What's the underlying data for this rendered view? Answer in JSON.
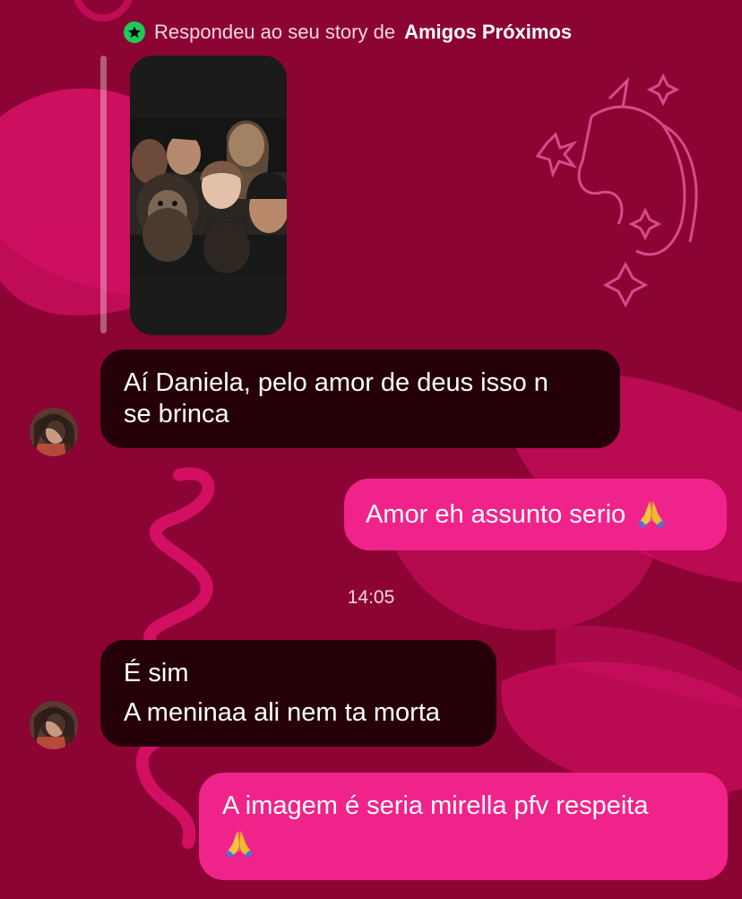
{
  "story_reply": {
    "icon": "star-icon",
    "prefix": "Respondeu ao seu story de",
    "highlight": "Amigos Próximos",
    "badge_color": "#1fc95a"
  },
  "messages": [
    {
      "direction": "incoming",
      "lines": [
        "Aí Daniela, pelo amor de deus isso n",
        "se brinca"
      ]
    },
    {
      "direction": "outgoing",
      "text": "Amor eh assunto serio",
      "emoji": "praying-hands-icon"
    },
    {
      "timestamp": "14:05"
    },
    {
      "direction": "incoming",
      "lines": [
        "É sim",
        "A meninaa ali nem ta morta"
      ]
    },
    {
      "direction": "outgoing",
      "text": "A imagem é seria mirella pfv respeita",
      "emoji": "praying-hands-icon"
    }
  ],
  "colors": {
    "background": "#8c0434",
    "incoming_bubble": "#250009",
    "outgoing_bubble": "#f0238b"
  }
}
